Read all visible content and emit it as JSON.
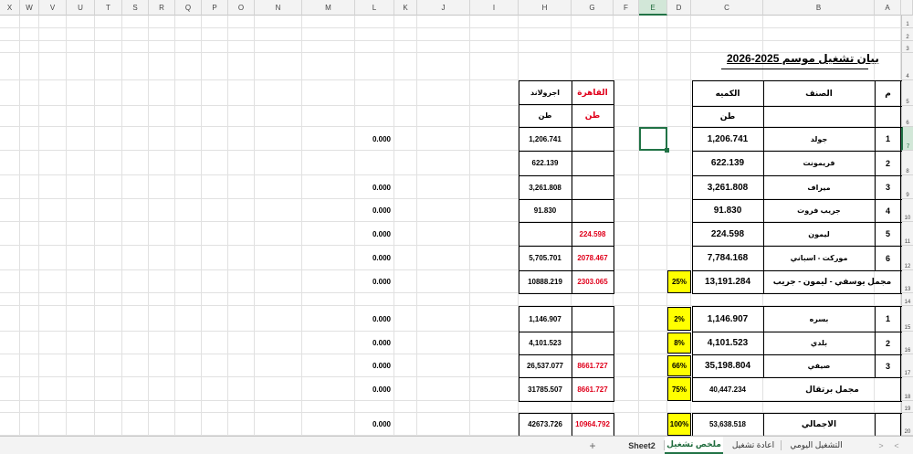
{
  "columns": {
    "headers": [
      "X",
      "W",
      "V",
      "U",
      "T",
      "S",
      "R",
      "Q",
      "P",
      "O",
      "N",
      "M",
      "L",
      "K",
      "J",
      "I",
      "H",
      "G",
      "F",
      "E",
      "D",
      "C",
      "B",
      "A"
    ],
    "selected": "E"
  },
  "rows": {
    "headers": [
      "1",
      "2",
      "3",
      "4",
      "5",
      "6",
      "7",
      "8",
      "9",
      "10",
      "11",
      "12",
      "13",
      "14",
      "15",
      "16",
      "17",
      "18",
      "19",
      "20"
    ],
    "selected": "7"
  },
  "sheet": {
    "title": "بيان تشغيل  موسم 2025-2026",
    "main_table": {
      "header_m": "م",
      "header_category": "الصنف",
      "header_qty": "الكميه",
      "unit": "طن"
    },
    "cairo_col": {
      "header": "القاهرة",
      "unit": "طن"
    },
    "agroland_col": {
      "header": "اجرولاند",
      "unit": "طن"
    },
    "rows": [
      {
        "num": "1",
        "category": "جولد",
        "qty": "1,206.741",
        "cairo": "",
        "agroland": "1,206.741",
        "extra": "0.000"
      },
      {
        "num": "2",
        "category": "فريمونت",
        "qty": "622.139",
        "cairo": "",
        "agroland": "622.139",
        "extra": ""
      },
      {
        "num": "3",
        "category": "ميراف",
        "qty": "3,261.808",
        "cairo": "",
        "agroland": "3,261.808",
        "extra": "0.000"
      },
      {
        "num": "4",
        "category": "جريب فروت",
        "qty": "91.830",
        "cairo": "",
        "agroland": "91.830",
        "extra": "0.000"
      },
      {
        "num": "5",
        "category": "ليمون",
        "qty": "224.598",
        "cairo": "224.598",
        "agroland": "",
        "extra": "0.000"
      },
      {
        "num": "6",
        "category": "موركت - اسباني",
        "qty": "7,784.168",
        "cairo": "2078.467",
        "agroland": "5,705.701",
        "extra": "0.000"
      }
    ],
    "subtotal1": {
      "label": "مجمل يوسفي - ليمون - جريب",
      "pct": "25%",
      "qty": "13,191.284",
      "cairo": "2303.065",
      "agroland": "10888.219",
      "extra": "0.000"
    },
    "rows2": [
      {
        "num": "1",
        "category": "بسره",
        "pct": "2%",
        "qty": "1,146.907",
        "cairo": "",
        "agroland": "1,146.907",
        "extra": "0.000"
      },
      {
        "num": "2",
        "category": "بلدي",
        "pct": "8%",
        "qty": "4,101.523",
        "cairo": "",
        "agroland": "4,101.523",
        "extra": "0.000"
      },
      {
        "num": "3",
        "category": "صيفي",
        "pct": "66%",
        "qty": "35,198.804",
        "cairo": "8661.727",
        "agroland": "26,537.077",
        "extra": "0.000"
      }
    ],
    "subtotal2": {
      "label": "مجمل برتقال",
      "pct": "75%",
      "qty": "40,447.234",
      "cairo": "8661.727",
      "agroland": "31785.507",
      "extra": "0.000"
    },
    "total": {
      "label": "الاجمالي",
      "pct": "100%",
      "qty": "53,638.518",
      "cairo": "10964.792",
      "agroland": "42673.726",
      "extra": "0.000"
    }
  },
  "tabs": {
    "items": [
      "التشغيل اليومي",
      "اعادة تشغيل",
      "ملخص تشغيل",
      "Sheet2"
    ],
    "active": "ملخص تشغيل",
    "add_symbol": "+",
    "prev_symbol": "<",
    "next_symbol": ">"
  }
}
